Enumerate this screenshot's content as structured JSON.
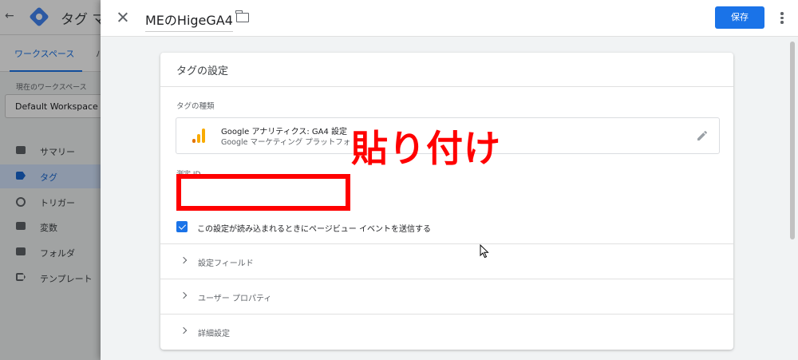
{
  "background_app": {
    "back_glyph": "←",
    "title": "タグ マ",
    "tab_workspace": "ワークスペース",
    "tab_second": "バ",
    "current_workspace_label": "現在のワークスペース",
    "workspace_name": "Default Workspace",
    "nav_items": [
      {
        "label": "サマリー",
        "icon": "summary-icon",
        "active": false
      },
      {
        "label": "タグ",
        "icon": "tag-icon",
        "active": true
      },
      {
        "label": "トリガー",
        "icon": "trigger-icon",
        "active": false
      },
      {
        "label": "変数",
        "icon": "variable-icon",
        "active": false
      },
      {
        "label": "フォルダ",
        "icon": "folder-icon",
        "active": false
      },
      {
        "label": "テンプレート",
        "icon": "template-icon",
        "active": false
      }
    ]
  },
  "sheet": {
    "tag_name": "MEのHigeGA4",
    "save_label": "保存"
  },
  "tag_config": {
    "title": "タグの設定",
    "type_label": "タグの種類",
    "type_name": "Google アナリティクス: GA4 設定",
    "type_sub": "Google マーケティング プラットフォ",
    "measurement_id_label": "測定 ID",
    "measurement_id_value": "",
    "send_pageview_checked": true,
    "send_pageview_label": "この設定が読み込まれるときにページビュー イベントを送信する",
    "sections": [
      "設定フィールド",
      "ユーザー プロパティ",
      "詳細設定"
    ]
  },
  "annotation": {
    "text": "貼り付け",
    "color": "#ff0000"
  },
  "colors": {
    "accent": "#1a73e8",
    "ga_bar_orange": "#f9ab00",
    "ga_bar_dark": "#e37400"
  }
}
